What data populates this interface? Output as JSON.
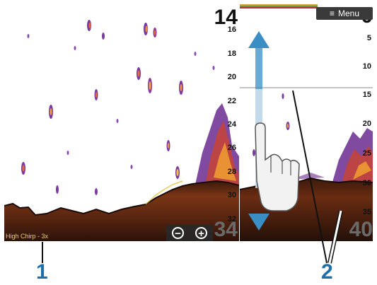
{
  "main_panel": {
    "current_depth": "14",
    "depth_scale": [
      "16",
      "18",
      "20",
      "22",
      "24",
      "26",
      "28",
      "30",
      "32"
    ],
    "range_bottom": "34",
    "mode_label": "High Chirp - 3x",
    "zoom_out_label": "−",
    "zoom_in_label": "+"
  },
  "right_panel": {
    "current_depth": "0",
    "menu_label": "Menu",
    "scale_top": [
      "5",
      "10"
    ],
    "scale_zoomed": [
      "15",
      "20",
      "25",
      "30",
      "35"
    ],
    "range_bottom": "40"
  },
  "callouts": {
    "one": "1",
    "two": "2"
  },
  "colors": {
    "callout": "#1e6ea8",
    "sonar_bottom": "#6b2e12",
    "arrow": "#3b8ec4"
  }
}
